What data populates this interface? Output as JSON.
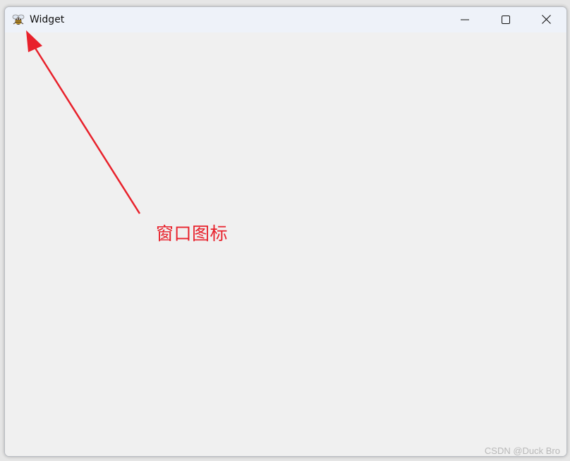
{
  "window": {
    "title": "Widget",
    "icon": "bee-app-icon",
    "controls": [
      "minimize-icon",
      "maximize-icon",
      "close-icon"
    ]
  },
  "annotation": {
    "text": "窗口图标",
    "color": "#e8212b"
  },
  "watermark": "CSDN @Duck Bro"
}
